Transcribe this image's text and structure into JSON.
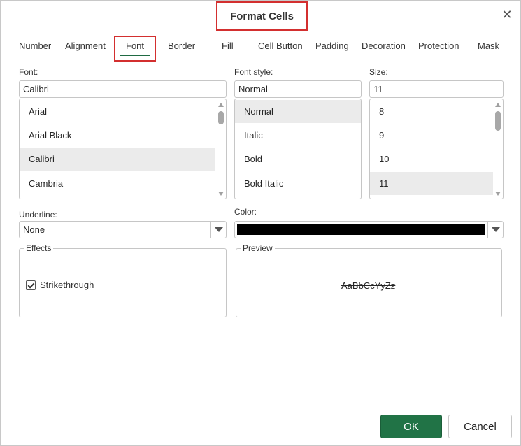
{
  "dialog": {
    "title": "Format Cells",
    "close_glyph": "✕"
  },
  "tabs": [
    {
      "label": "Number"
    },
    {
      "label": "Alignment"
    },
    {
      "label": "Font",
      "active": true
    },
    {
      "label": "Border"
    },
    {
      "label": "Fill"
    },
    {
      "label": "Cell Button"
    },
    {
      "label": "Padding"
    },
    {
      "label": "Decoration"
    },
    {
      "label": "Protection"
    },
    {
      "label": "Mask"
    }
  ],
  "font": {
    "label": "Font:",
    "value": "Calibri",
    "items": [
      "Arial",
      "Arial Black",
      "Calibri",
      "Cambria"
    ],
    "selected": "Calibri"
  },
  "font_style": {
    "label": "Font style:",
    "value": "Normal",
    "items": [
      "Normal",
      "Italic",
      "Bold",
      "Bold Italic"
    ],
    "selected": "Normal"
  },
  "size": {
    "label": "Size:",
    "value": "11",
    "items": [
      "8",
      "9",
      "10",
      "11"
    ],
    "selected": "11"
  },
  "underline": {
    "label": "Underline:",
    "value": "None"
  },
  "color": {
    "label": "Color:",
    "value": "#000000"
  },
  "effects": {
    "title": "Effects",
    "strikethrough_label": "Strikethrough",
    "strikethrough_checked": true
  },
  "preview": {
    "title": "Preview",
    "sample_text": "AaBbCcYyZz"
  },
  "buttons": {
    "ok_label": "OK",
    "cancel_label": "Cancel"
  }
}
